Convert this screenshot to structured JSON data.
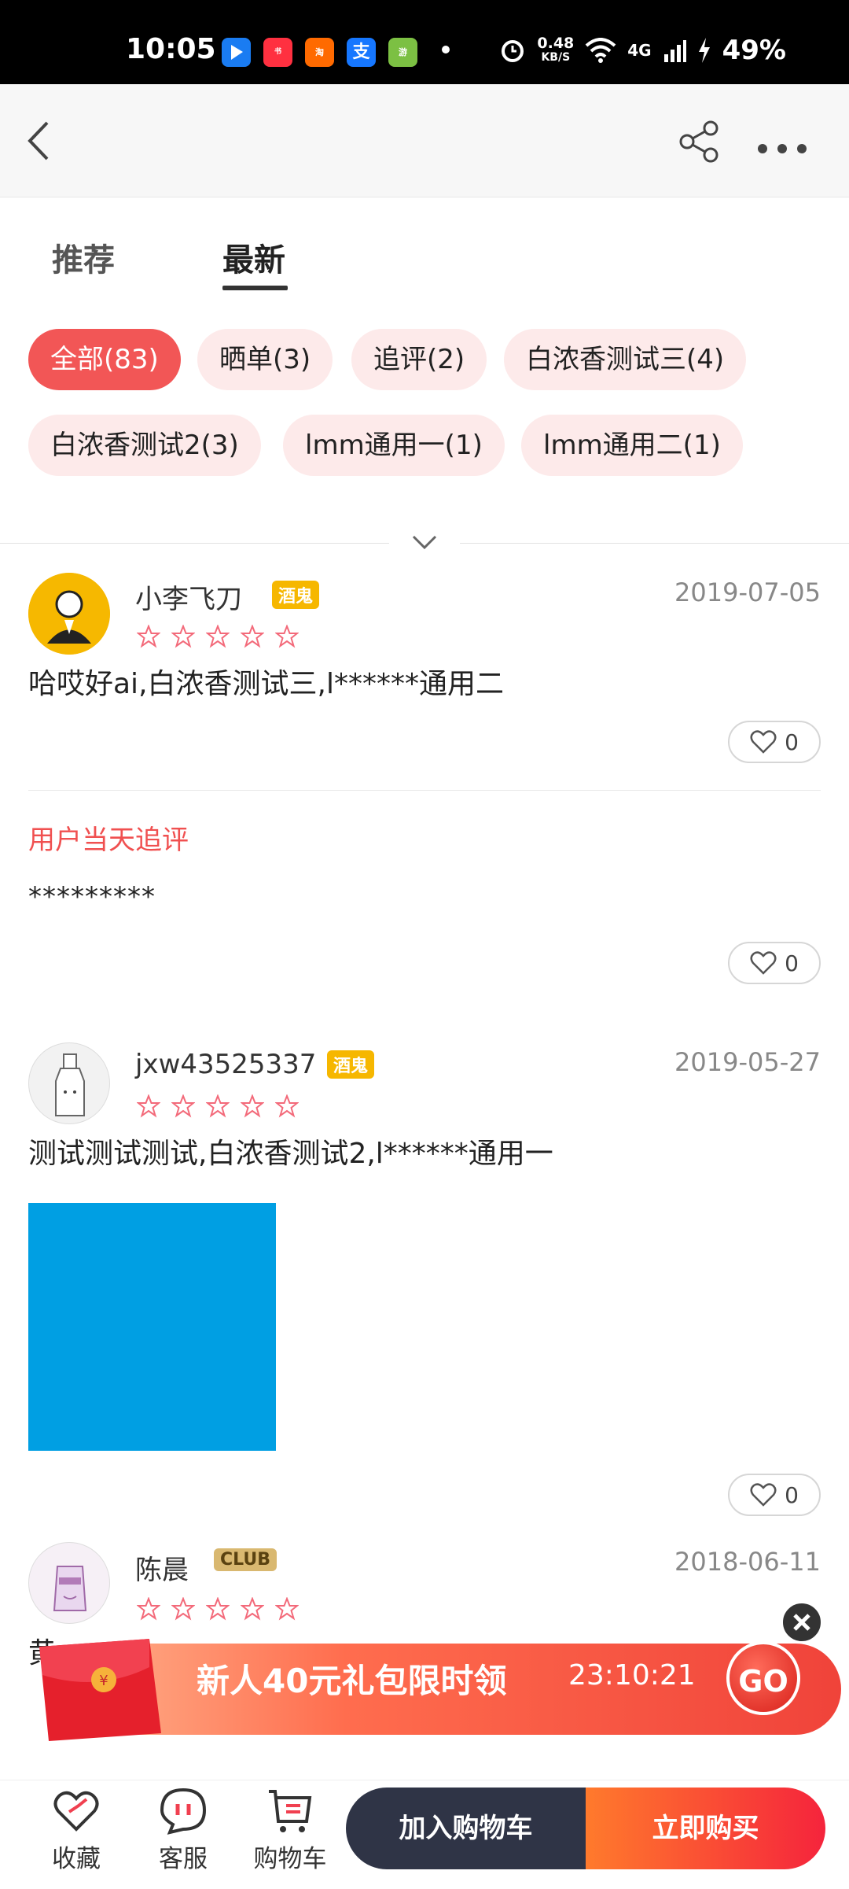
{
  "status_bar": {
    "time": "10:05",
    "speed_value": "0.48",
    "speed_unit": "KB/S",
    "network": "4G",
    "battery": "49%",
    "app_icons": [
      "tencent-maps",
      "xiaohongshu",
      "taobao-special",
      "alipay",
      "app-game"
    ]
  },
  "header": {
    "back_icon": "chevron-left-icon",
    "share_icon": "share-icon",
    "more_icon": "more-dots-icon"
  },
  "tabs": {
    "recommend": "推荐",
    "latest": "最新"
  },
  "filters": [
    {
      "label": "全部(83)",
      "active": true
    },
    {
      "label": "晒单(3)",
      "active": false
    },
    {
      "label": "追评(2)",
      "active": false
    },
    {
      "label": "白浓香测试三(4)",
      "active": false
    },
    {
      "label": "白浓香测试2(3)",
      "active": false
    },
    {
      "label": "lmm通用一(1)",
      "active": false
    },
    {
      "label": "lmm通用二(1)",
      "active": false
    }
  ],
  "reviews": [
    {
      "user": "小李飞刀",
      "badge": "酒鬼",
      "date": "2019-07-05",
      "rating": 5,
      "text": "哈哎好ai,白浓香测试三,l******通用二",
      "likes": "0",
      "followup_title": "用户当天追评",
      "followup_text": "*********",
      "followup_likes": "0"
    },
    {
      "user": "jxw43525337",
      "badge": "酒鬼",
      "date": "2019-05-27",
      "rating": 5,
      "text": "测试测试测试,白浓香测试2,l******通用一",
      "likes": "0"
    },
    {
      "user": "陈晨",
      "badge": "CLUB",
      "date": "2018-06-11",
      "rating": 5,
      "text": "黄"
    }
  ],
  "promo": {
    "title": "新人40元礼包限时领",
    "timer": "23:10:21",
    "go": "GO"
  },
  "bottom_bar": {
    "favorite": "收藏",
    "service": "客服",
    "cart": "购物车",
    "add_to_cart": "加入购物车",
    "buy_now": "立即购买"
  },
  "colors": {
    "accent_red": "#f25656",
    "chip_bg": "#fdeaea",
    "dark_button": "#2f3446",
    "photo_blue": "#009fe3"
  }
}
